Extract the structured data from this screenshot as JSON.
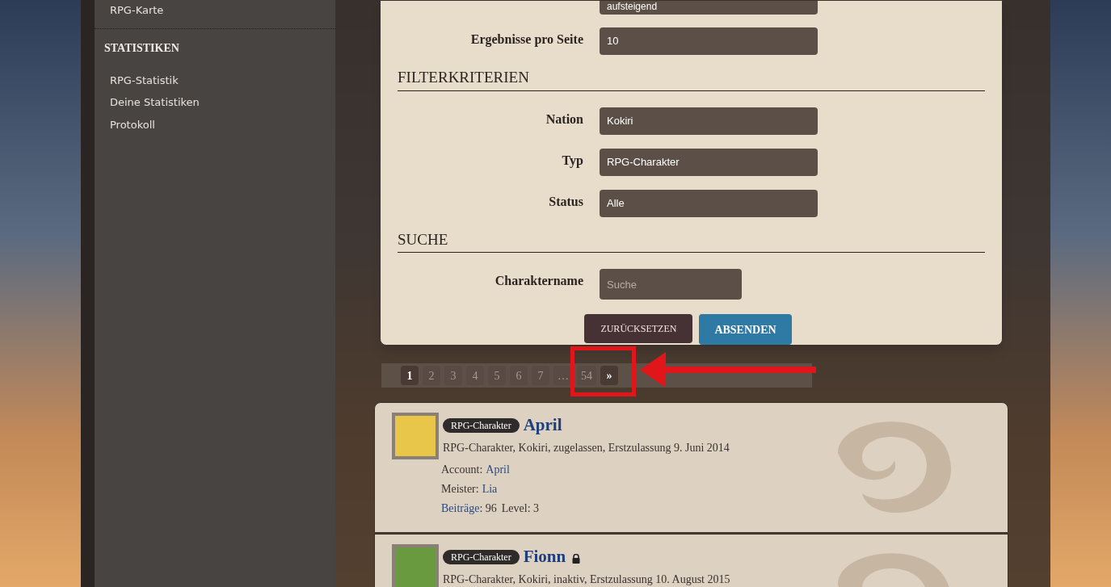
{
  "sidebar": {
    "top_items": [
      "RPG-Karte"
    ],
    "sections": [
      {
        "title": "STATISTIKEN",
        "items": [
          "RPG-Statistik",
          "Deine Statistiken",
          "Protokoll"
        ]
      }
    ]
  },
  "form": {
    "partial_field": {
      "value": "aufsteigend"
    },
    "fields": [
      {
        "label": "Ergebnisse pro Seite",
        "value": "10"
      }
    ],
    "groups": [
      {
        "title": "FILTERKRITERIEN",
        "fields": [
          {
            "label": "Nation",
            "value": "Kokiri"
          },
          {
            "label": "Typ",
            "value": "RPG-Charakter"
          },
          {
            "label": "Status",
            "value": "Alle"
          }
        ]
      },
      {
        "title": "SUCHE",
        "fields": [
          {
            "label": "Charaktername",
            "placeholder": "Suche"
          }
        ]
      }
    ],
    "buttons": [
      {
        "label": "ZURÜCKSETZEN",
        "kind": "reset"
      },
      {
        "label": "ABSENDEN",
        "kind": "submit"
      }
    ]
  },
  "pagination": {
    "pages": [
      {
        "label": "1",
        "selected": true
      },
      {
        "label": "2",
        "selected": false
      },
      {
        "label": "3",
        "selected": false
      },
      {
        "label": "4",
        "selected": false
      },
      {
        "label": "5",
        "selected": false
      },
      {
        "label": "6",
        "selected": false
      },
      {
        "label": "7",
        "selected": false
      },
      {
        "label": "…",
        "selected": false
      },
      {
        "label": "54",
        "selected": false
      }
    ],
    "next": "»"
  },
  "characters": [
    {
      "badge": "RPG-Charakter",
      "name": "April",
      "locked": false,
      "summary": "RPG-Charakter, Kokiri, zugelassen, Erstzulassung 9. Juni 2014",
      "account_label": "Account:",
      "account": "April",
      "master_label": "Meister:",
      "master": "Lia",
      "posts_label": "Beiträge",
      "posts": ": 96",
      "level": "Level: 3"
    },
    {
      "badge": "RPG-Charakter",
      "name": "Fionn",
      "locked": true,
      "summary": "RPG-Charakter, Kokiri, inaktiv, Erstzulassung 10. August 2015"
    }
  ]
}
